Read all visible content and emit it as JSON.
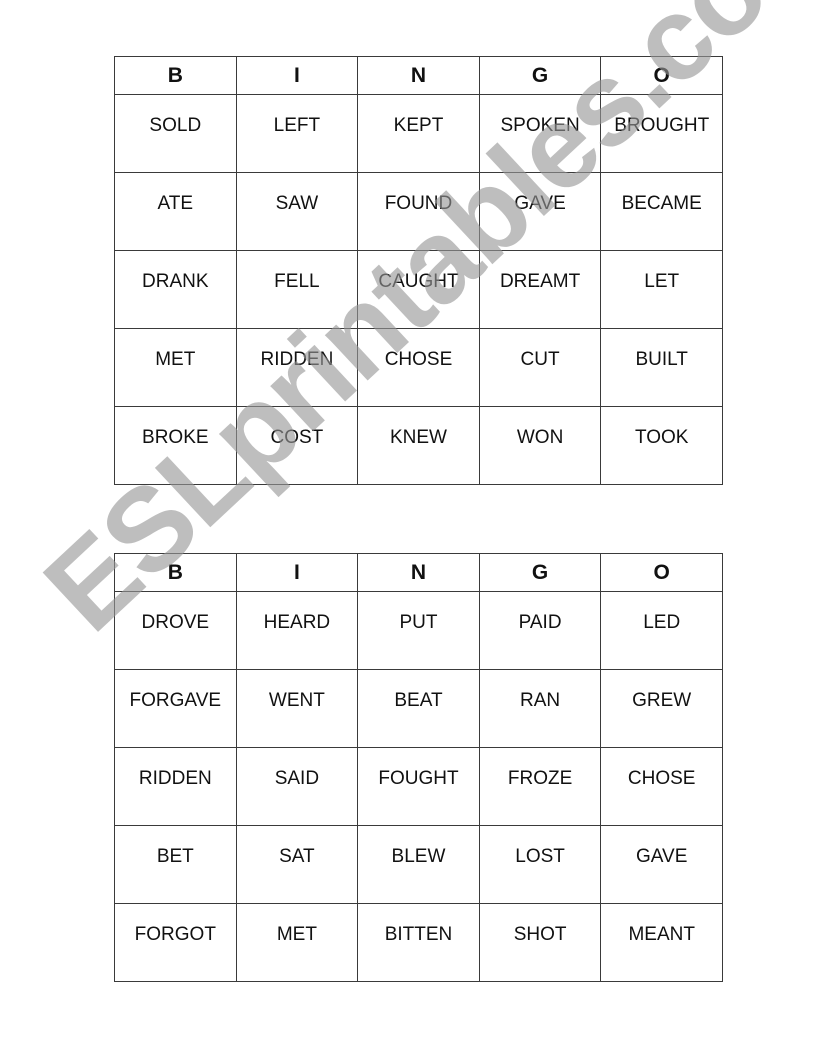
{
  "cards": [
    {
      "headers": [
        "B",
        "I",
        "N",
        "G",
        "O"
      ],
      "rows": [
        [
          "SOLD",
          "LEFT",
          "KEPT",
          "SPOKEN",
          "BROUGHT"
        ],
        [
          "ATE",
          "SAW",
          "FOUND",
          "GAVE",
          "BECAME"
        ],
        [
          "DRANK",
          "FELL",
          "CAUGHT",
          "DREAMT",
          "LET"
        ],
        [
          "MET",
          "RIDDEN",
          "CHOSE",
          "CUT",
          "BUILT"
        ],
        [
          "BROKE",
          "COST",
          "KNEW",
          "WON",
          "TOOK"
        ]
      ]
    },
    {
      "headers": [
        "B",
        "I",
        "N",
        "G",
        "O"
      ],
      "rows": [
        [
          "DROVE",
          "HEARD",
          "PUT",
          "PAID",
          "LED"
        ],
        [
          "FORGAVE",
          "WENT",
          "BEAT",
          "RAN",
          "GREW"
        ],
        [
          "RIDDEN",
          "SAID",
          "FOUGHT",
          "FROZE",
          "CHOSE"
        ],
        [
          "BET",
          "SAT",
          "BLEW",
          "LOST",
          "GAVE"
        ],
        [
          "FORGOT",
          "MET",
          "BITTEN",
          "SHOT",
          "MEANT"
        ]
      ]
    }
  ],
  "watermark": "ESLprintables.com"
}
